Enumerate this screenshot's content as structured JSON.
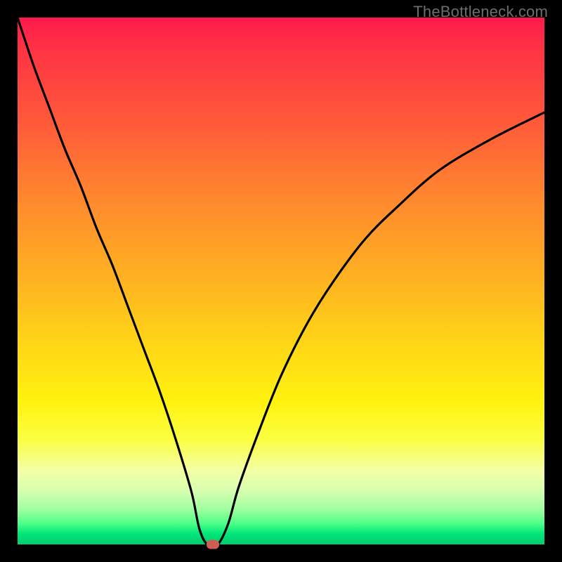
{
  "watermark": "TheBottleneck.com",
  "colors": {
    "background": "#000000",
    "curve": "#000000",
    "marker": "#cc5e55",
    "gradient_top": "#ff1a4d",
    "gradient_bottom": "#00cc6e"
  },
  "chart_data": {
    "type": "line",
    "title": "",
    "xlabel": "",
    "ylabel": "",
    "xlim": [
      0,
      100
    ],
    "ylim": [
      0,
      100
    ],
    "series": [
      {
        "name": "bottleneck-curve",
        "x": [
          0,
          3,
          6,
          9,
          12,
          15,
          18,
          21,
          24,
          27,
          30,
          33,
          34.5,
          36,
          38,
          40,
          42,
          46,
          50,
          55,
          60,
          66,
          72,
          80,
          90,
          100
        ],
        "y": [
          100,
          91,
          83,
          75,
          68,
          60,
          53,
          45,
          37,
          29,
          20,
          10,
          3,
          0,
          0,
          4,
          11,
          22,
          32,
          42,
          50,
          58,
          64,
          71,
          77,
          82
        ]
      }
    ],
    "annotations": [
      {
        "name": "optimal-point",
        "x": 37,
        "y": 0
      }
    ]
  }
}
